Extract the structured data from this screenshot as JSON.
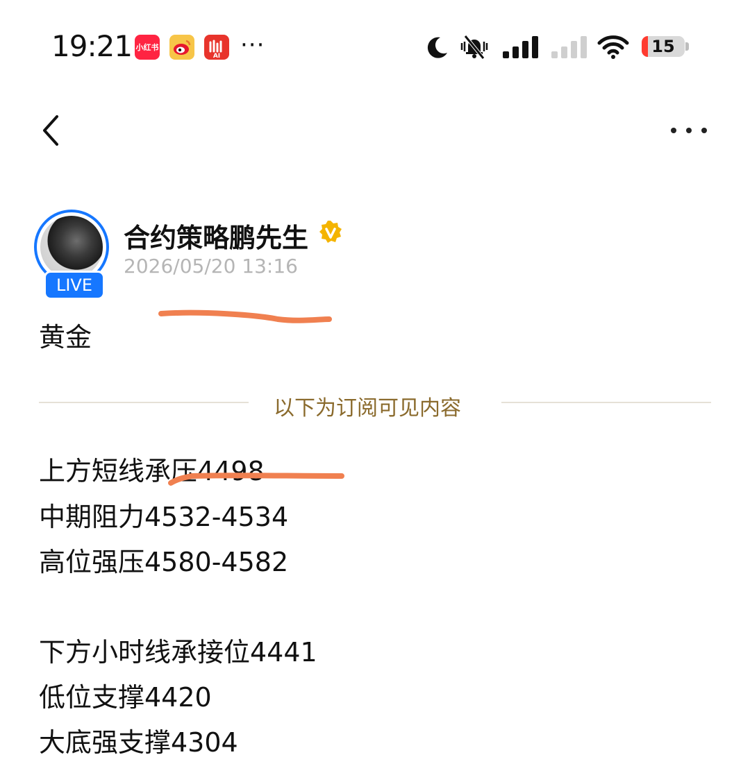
{
  "status_bar": {
    "time": "19:21",
    "app_icons": [
      {
        "name": "xiaohongshu-icon",
        "label": "小红书",
        "color": "#ff2442"
      },
      {
        "name": "weibo-icon",
        "color": "#f7c548"
      },
      {
        "name": "ai-app-icon",
        "label": "AI",
        "color": "#e8342c"
      }
    ],
    "more": "···",
    "battery": {
      "level": 15,
      "fill_color": "#ff3b30"
    }
  },
  "nav": {
    "back_icon": "chevron-left-icon",
    "more_icon": "more-horizontal-icon"
  },
  "post": {
    "author": "合约策略鹏先生",
    "verified_icon": "verified-badge-icon",
    "verified_color": "#f4b400",
    "live_badge": "LIVE",
    "live_color": "#1677ff",
    "date": "2026/05/20 13:16",
    "title": "黄金",
    "subscriber_divider": "以下为订阅可见内容",
    "lines": [
      "上方短线承压4498",
      "中期阻力4532-4534",
      "高位强压4580-4582",
      "",
      "下方小时线承接位4441",
      "低位支撑4420",
      "大底强支撑4304"
    ]
  },
  "annotation_color": "#f08050"
}
